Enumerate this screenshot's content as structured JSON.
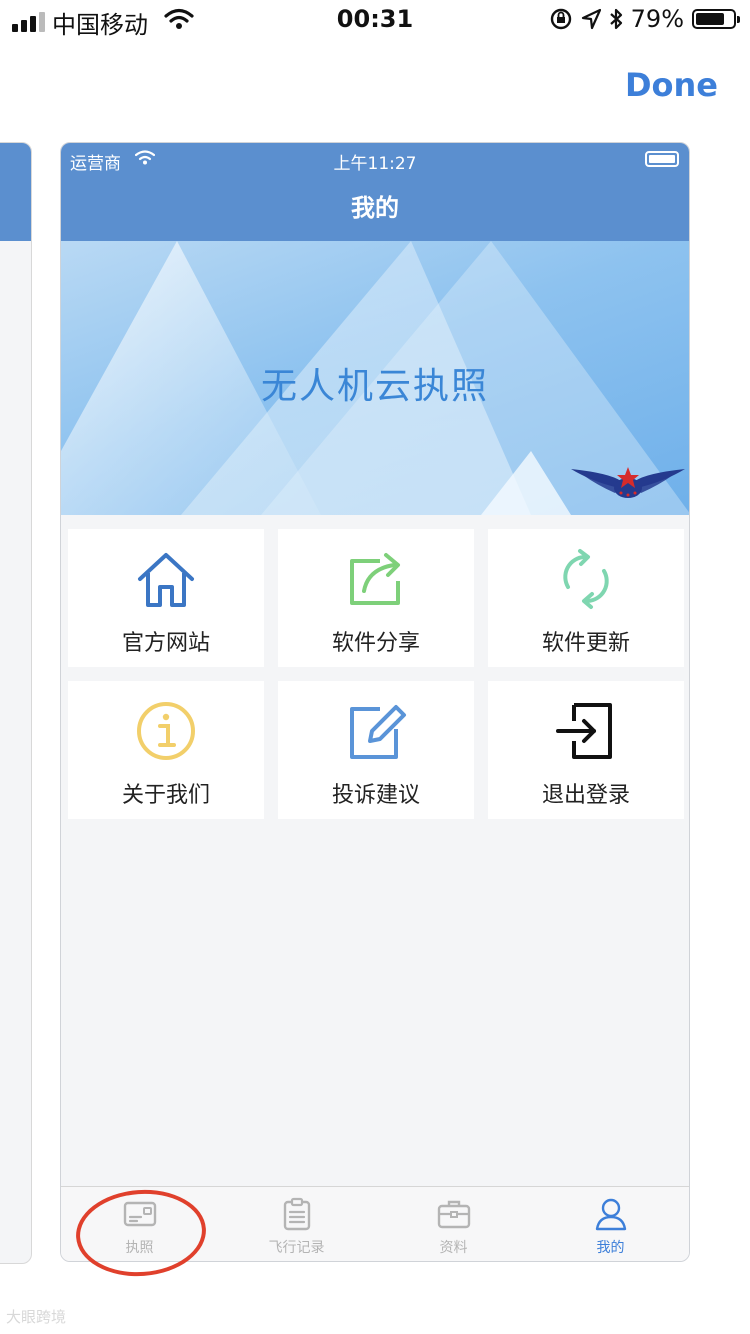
{
  "status_bar": {
    "carrier": "中国移动",
    "time": "00:31",
    "battery_percent": "79%",
    "battery_level": 0.79,
    "signal_bars": 3
  },
  "done_label": "Done",
  "app": {
    "status_carrier": "运营商",
    "status_time": "上午11:27",
    "nav_title": "我的",
    "banner_title": "无人机云执照",
    "colors": {
      "nav": "#5b8fcf",
      "accent": "#3d7fd9",
      "annotation": "#e0402c"
    },
    "tiles": [
      {
        "label": "官方网站",
        "icon": "house-icon",
        "color": "#3b76c4"
      },
      {
        "label": "软件分享",
        "icon": "share-icon",
        "color": "#7ed07a"
      },
      {
        "label": "软件更新",
        "icon": "refresh-icon",
        "color": "#7fd6b0"
      },
      {
        "label": "关于我们",
        "icon": "info-icon",
        "color": "#f2cf6a"
      },
      {
        "label": "投诉建议",
        "icon": "edit-icon",
        "color": "#5a94d8"
      },
      {
        "label": "退出登录",
        "icon": "logout-icon",
        "color": "#111111"
      }
    ],
    "tabs": [
      {
        "label": "执照",
        "icon": "license-card-icon",
        "active": false
      },
      {
        "label": "飞行记录",
        "icon": "clipboard-icon",
        "active": false
      },
      {
        "label": "资料",
        "icon": "briefcase-icon",
        "active": false
      },
      {
        "label": "我的",
        "icon": "person-icon",
        "active": true
      }
    ]
  },
  "watermark": "大眼跨境"
}
